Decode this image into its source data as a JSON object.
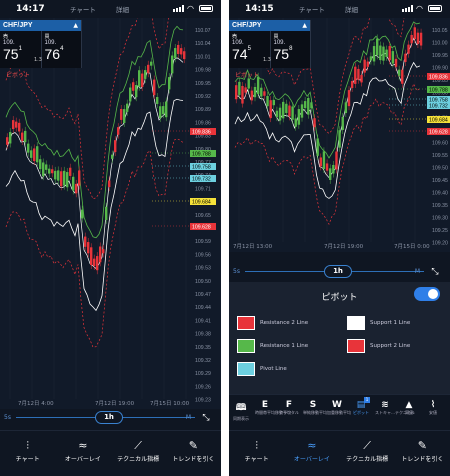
{
  "left": {
    "status": {
      "time": "14:17",
      "tabs": [
        "チャート",
        "詳細"
      ]
    },
    "quote": {
      "pair": "CHF/JPY",
      "bid_label": "売",
      "ask_label": "買",
      "bid_small": "109.",
      "ask_small": "109.",
      "bid_big": "75",
      "bid_sup": "1",
      "ask_big": "76",
      "ask_sup": "4",
      "spread": "1.3"
    },
    "indicator_label": "ピボット",
    "y_ticks": [
      "110.07",
      "110.04",
      "110.01",
      "109.98",
      "109.95",
      "109.92",
      "109.89",
      "109.86",
      "109.83",
      "109.80",
      "109.77",
      "109.74",
      "109.71",
      "109.68",
      "109.65",
      "109.62",
      "109.59",
      "109.56",
      "109.53",
      "109.50",
      "109.47",
      "109.44",
      "109.41",
      "109.38",
      "109.35",
      "109.32",
      "109.29",
      "109.26",
      "109.23"
    ],
    "tags": [
      "109.836",
      "109.788",
      "109.758",
      "109.732",
      "109.684",
      "109.628"
    ],
    "x_labels": [
      "7月12日 4:00",
      "7月12日 19:00",
      "7月15日 10:00"
    ],
    "timeframe": {
      "label": "1h",
      "lo": "5s",
      "hi": "M"
    }
  },
  "right": {
    "status": {
      "time": "14:15",
      "tabs": [
        "チャート",
        "詳細"
      ]
    },
    "quote": {
      "pair": "CHF/JPY",
      "bid_label": "売",
      "ask_label": "買",
      "bid_small": "109.",
      "ask_small": "109.",
      "bid_big": "74",
      "bid_sup": "5",
      "ask_big": "75",
      "ask_sup": "8",
      "spread": "1.3"
    },
    "indicator_label": "ピボット",
    "y_ticks": [
      "110.05",
      "110.00",
      "109.95",
      "109.90",
      "109.85",
      "109.80",
      "109.75",
      "109.70",
      "109.65",
      "109.60",
      "109.55",
      "109.50",
      "109.45",
      "109.40",
      "109.35",
      "109.30",
      "109.25",
      "109.20"
    ],
    "tags": [
      "109.836",
      "109.788",
      "109.758",
      "109.732",
      "109.684",
      "109.628"
    ],
    "x_labels": [
      "7月12日 13:00",
      "7月12日 19:00",
      "7月15日 0:00"
    ],
    "timeframe": {
      "label": "1h",
      "lo": "5s",
      "hi": "M"
    },
    "panel": {
      "title": "ピボット",
      "items": [
        "Resistance 2 Line",
        "Support 1 Line",
        "Resistance 1 Line",
        "Support 2 Line",
        "Pivot Line"
      ]
    },
    "indicators": [
      {
        "glyph": "🕮",
        "label": "同期表示"
      },
      {
        "glyph": "E",
        "label": "時間帯平均移動平均"
      },
      {
        "glyph": "F",
        "label": "フラクタル"
      },
      {
        "glyph": "S",
        "label": "単純移動平均"
      },
      {
        "glyph": "W",
        "label": "加重移動平均"
      },
      {
        "glyph": "▤",
        "label": "ピボット",
        "badge": "1"
      },
      {
        "glyph": "≋",
        "label": "ストキャ…テクニカル"
      },
      {
        "glyph": "▲",
        "label": "高値"
      },
      {
        "glyph": "⌇",
        "label": "安値"
      }
    ]
  },
  "nav": [
    "チャート",
    "オーバーレイ",
    "テクニカル指標",
    "トレンドを引く"
  ],
  "colors": {
    "red": "#e8343a",
    "green": "#56b84a",
    "cyan": "#6dd0e0",
    "yellow": "#f5e23a",
    "accent": "#2f7fe8"
  }
}
